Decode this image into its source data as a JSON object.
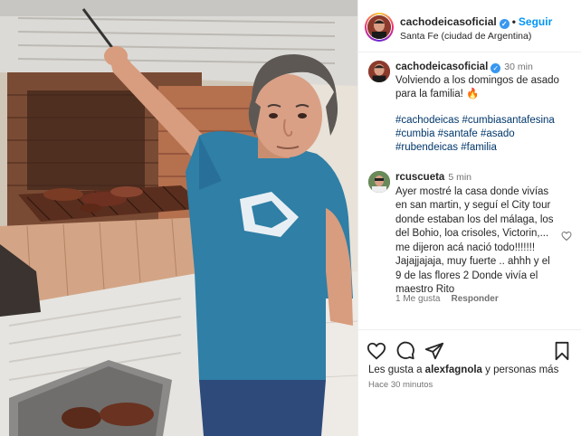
{
  "post": {
    "username": "cachodeicasoficial",
    "follow_label": "Seguir",
    "location": "Santa Fe (ciudad de Argentina)",
    "caption_time": "30 min",
    "caption_text": "Volviendo a los domingos de asado para la familia! 🔥",
    "hashtags": "#cachodeicas #cumbiasantafesina #cumbia #santafe #asado #rubendeicas #familia",
    "likes_prefix": "Les gusta a",
    "likes_user": "alexfagnola",
    "likes_suffix": "y personas más",
    "posted_ago": "Hace 30 minutos"
  },
  "comment": {
    "username": "rcuscueta",
    "time": "5 min",
    "text": "Ayer mostré la casa donde vivías en san martin, y seguí el City tour donde estaban los del málaga, los del Bohio, loa crisoles, Victorin,... me dijeron acá nació todo!!!!!!! Jajajjajaja, muy fuerte .. ahhh y el 9 de las flores 2 Donde vivía el maestro Rito",
    "likes": "1 Me gusta",
    "reply_label": "Responder"
  },
  "icons": {
    "like": "heart-icon",
    "comment": "comment-icon",
    "share": "share-icon",
    "save": "bookmark-icon",
    "verified": "verified-badge-icon"
  },
  "colors": {
    "accent": "#0095f6",
    "hashtag": "#00376b",
    "muted": "#737373",
    "shirt": "#2f7fa6"
  }
}
